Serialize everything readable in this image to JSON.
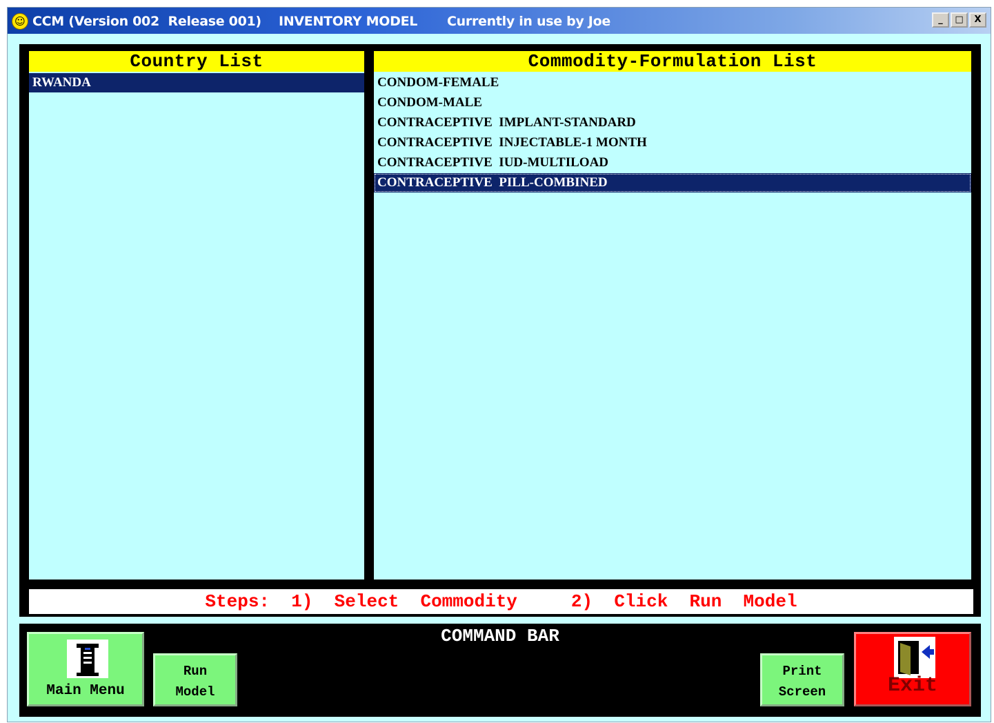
{
  "window": {
    "title_app": "CCM (Version 002  Release 001)",
    "title_model": "INVENTORY MODEL",
    "title_user": "Currently in use by Joe",
    "icon": "smiley-icon",
    "controls": {
      "minimize": "_",
      "maximize": "□",
      "close": "X"
    }
  },
  "country_list": {
    "header": "Country List",
    "items": [
      "RWANDA"
    ],
    "selected_index": 0
  },
  "commodity_list": {
    "header": "Commodity-Formulation List",
    "items": [
      "CONDOM-FEMALE",
      "CONDOM-MALE",
      "CONTRACEPTIVE  IMPLANT-STANDARD",
      "CONTRACEPTIVE  INJECTABLE-1 MONTH",
      "CONTRACEPTIVE  IUD-MULTILOAD",
      "CONTRACEPTIVE  PILL-COMBINED"
    ],
    "selected_index": 5
  },
  "steps_text": "Steps:  1)  Select  Commodity     2)  Click  Run  Model",
  "command_bar": {
    "title": "COMMAND  BAR",
    "main_menu": "Main Menu",
    "run_model_line1": "Run",
    "run_model_line2": "Model",
    "print_screen_line1": "Print",
    "print_screen_line2": "Screen",
    "exit": "Exit"
  },
  "colors": {
    "panel_bg": "#000000",
    "list_bg": "#c0ffff",
    "header_bg": "#ffff00",
    "selection_bg": "#0d246a",
    "steps_text": "#ff0000",
    "button_green": "#7cf57c",
    "exit_red": "#ff0000"
  }
}
